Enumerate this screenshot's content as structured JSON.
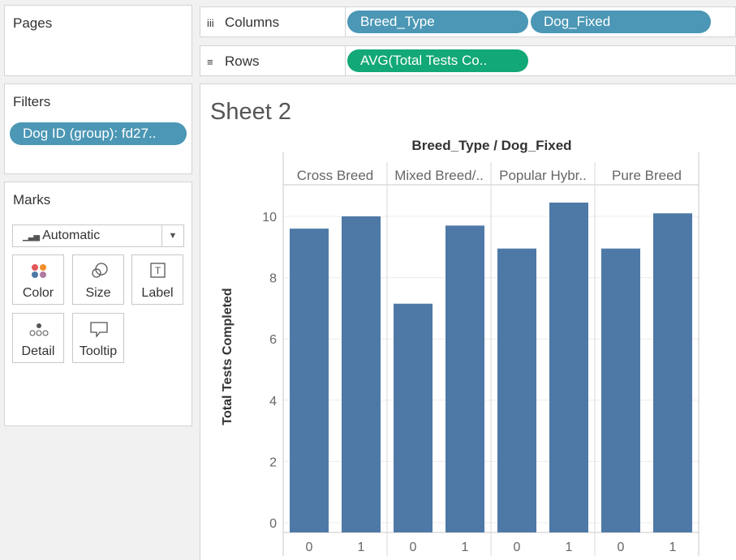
{
  "pages": {
    "title": "Pages"
  },
  "filters": {
    "title": "Filters",
    "pill": "Dog ID (group): fd27.."
  },
  "marks": {
    "title": "Marks",
    "type_selected": "Automatic",
    "buttons": [
      {
        "label": "Color",
        "icon": "color-icon"
      },
      {
        "label": "Size",
        "icon": "size-icon"
      },
      {
        "label": "Label",
        "icon": "label-icon"
      },
      {
        "label": "Detail",
        "icon": "detail-icon"
      },
      {
        "label": "Tooltip",
        "icon": "tooltip-icon"
      }
    ]
  },
  "shelves": {
    "columns": {
      "label": "Columns",
      "icon": "iii",
      "pills": [
        "Breed_Type",
        "Dog_Fixed"
      ]
    },
    "rows": {
      "label": "Rows",
      "icon": "≡",
      "pills": [
        "AVG(Total Tests Co.."
      ]
    }
  },
  "sheet": {
    "title": "Sheet 2"
  },
  "colors": {
    "bar": "#4e79a7",
    "dimension_pill": "#4b97b5",
    "measure_pill": "#12a877"
  },
  "chart_data": {
    "type": "bar",
    "header_title": "Breed_Type / Dog_Fixed",
    "ylabel": "Total Tests Completed",
    "ylim": [
      0,
      10.5
    ],
    "yticks": [
      0,
      2,
      4,
      6,
      8,
      10
    ],
    "groups": [
      {
        "name": "Cross Breed",
        "categories": [
          "0",
          "1"
        ],
        "values": [
          9.6,
          10.0
        ]
      },
      {
        "name": "Mixed Breed/..",
        "categories": [
          "0",
          "1"
        ],
        "values": [
          7.15,
          9.7
        ]
      },
      {
        "name": "Popular Hybr..",
        "categories": [
          "0",
          "1"
        ],
        "values": [
          8.95,
          10.45
        ]
      },
      {
        "name": "Pure Breed",
        "categories": [
          "0",
          "1"
        ],
        "values": [
          8.95,
          10.1
        ]
      }
    ]
  }
}
